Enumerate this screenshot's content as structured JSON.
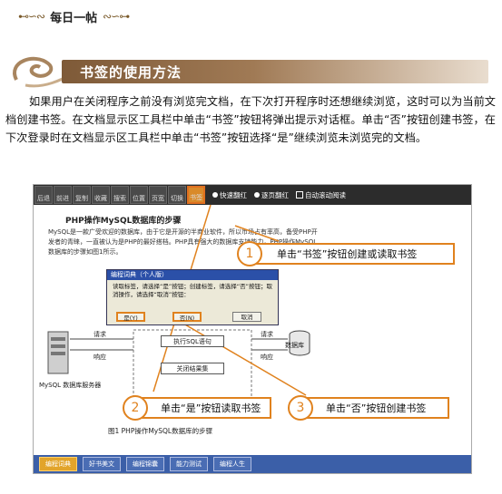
{
  "header": {
    "title": "每日一帖"
  },
  "section": {
    "title": "书签的使用方法"
  },
  "paragraph": "如果用户在关闭程序之前没有浏览完文档，在下次打开程序时还想继续浏览，这时可以为当前文档创建书签。在文档显示区工具栏中单击“书签”按钮将弹出提示对话框。单击“否”按钮创建书签，在下次登录时在文档显示区工具栏中单击“书签”按钮选择“是”继续浏览未浏览完的文档。",
  "screenshot": {
    "toolbar": {
      "buttons": [
        "后退",
        "前进",
        "复制",
        "收藏",
        "搜索",
        "位置",
        "页宽",
        "切换",
        "书签"
      ],
      "options": [
        "快速翻红",
        "逐页翻红",
        "自动滚动阅读"
      ]
    },
    "doc_title": "PHP操作MySQL数据库的步骤",
    "doc_text": "MySQL是一款广受欢迎的数据库，由于它是开源的半商业软件，所以市场占有率高，备受PHP开发者的青睐，一直被认为是PHP的最好搭档。PHP具有强大的数据库支持能力，PHP操作MySQL数据库的步骤如图1所示。",
    "dialog": {
      "caption": "编程词典（个人版）",
      "message": "读取标签，请选择“是”按钮；创建标签，请选择“否”按钮；取消操作，请选择“取消”按钮：",
      "yes": "是(Y)",
      "no": "否(N)",
      "cancel": "取消"
    },
    "flow": {
      "request1": "请求",
      "response1": "响应",
      "execute": "执行SQL语句",
      "close": "关闭结果集",
      "request2": "请求",
      "response2": "响应",
      "db": "数据库",
      "server": "MySQL 数据库服务器"
    },
    "figure_caption": "图1  PHP操作MySQL数据库的步骤",
    "callouts": [
      {
        "num": "1",
        "text": "单击“书签”按钮创建或读取书签"
      },
      {
        "num": "2",
        "text": "单击“是”按钮读取书签"
      },
      {
        "num": "3",
        "text": "单击“否”按钮创建书签"
      }
    ],
    "statusbar": [
      "编程词典",
      "好书美文",
      "编程锦囊",
      "能力测试",
      "编程人生"
    ]
  },
  "colors": {
    "accent": "#e0821e",
    "banner": "#8a6440",
    "statusbar": "#3b5fa8"
  }
}
